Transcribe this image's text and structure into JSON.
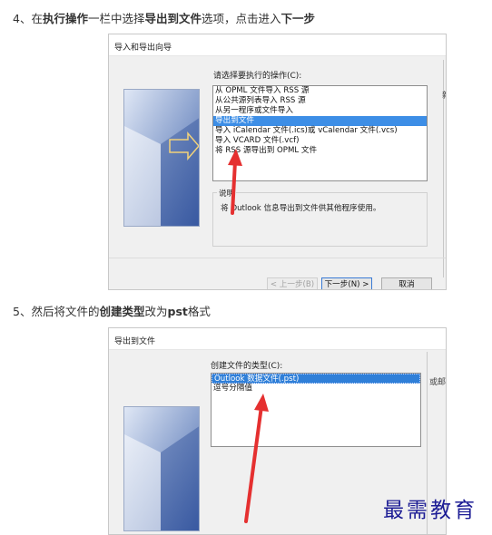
{
  "step4": {
    "prefix": "4、在",
    "b1": "执行操作",
    "mid1": "一栏中选择",
    "b2": "导出到文件",
    "mid2": "选项，点击进入",
    "b3": "下一步"
  },
  "dialog1": {
    "title": "导入和导出向导",
    "list_label": "请选择要执行的操作(C):",
    "items": [
      "从 OPML 文件导入 RSS 源",
      "从公共源列表导入 RSS 源",
      "从另一程序或文件导入",
      "导出到文件",
      "导入 iCalendar 文件(.ics)或 vCalendar 文件(.vcs)",
      "导入 VCARD 文件(.vcf)",
      "将 RSS 源导出到 OPML 文件"
    ],
    "selected_index": 3,
    "desc_title": "说明",
    "desc_text": "将 Outlook 信息导出到文件供其他程序使用。",
    "back_button": "< 上一步(B)",
    "next_button": "下一步(N) >",
    "cancel_button": "取消",
    "behind_text": "新"
  },
  "step5": {
    "prefix": "5、然后将文件的",
    "b1": "创建类型",
    "mid1": "改为",
    "b2": "pst",
    "suffix": "格式"
  },
  "dialog2": {
    "title": "导出到文件",
    "list_label": "创建文件的类型(C):",
    "items": [
      "Outlook 数据文件(.pst)",
      "逗号分隔值"
    ],
    "selected_index": 0,
    "behind_text": "或邮件"
  },
  "watermark": "最需教育",
  "colors": {
    "selection": "#3d8ee6",
    "annotation_arrow": "#e53030",
    "watermark": "#1d1d95"
  }
}
